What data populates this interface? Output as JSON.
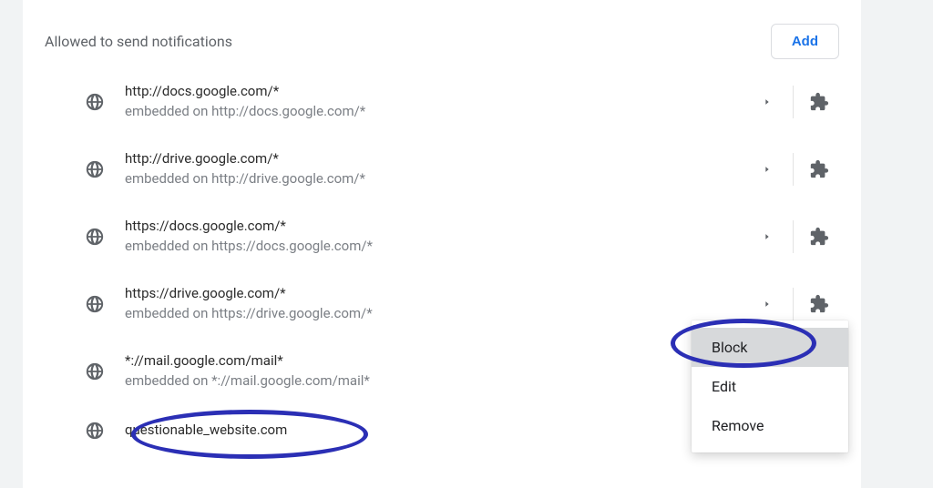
{
  "header": {
    "title": "Allowed to send notifications",
    "add_label": "Add"
  },
  "sites": [
    {
      "url": "http://docs.google.com/*",
      "embed": "embedded on http://docs.google.com/*",
      "show_icons": true
    },
    {
      "url": "http://drive.google.com/*",
      "embed": "embedded on http://drive.google.com/*",
      "show_icons": true
    },
    {
      "url": "https://docs.google.com/*",
      "embed": "embedded on https://docs.google.com/*",
      "show_icons": true
    },
    {
      "url": "https://drive.google.com/*",
      "embed": "embedded on https://drive.google.com/*",
      "show_icons": true
    },
    {
      "url": "*://mail.google.com/mail*",
      "embed": "embedded on *://mail.google.com/mail*",
      "show_icons": false
    },
    {
      "url": "questionable_website.com",
      "embed": "",
      "show_icons": false
    }
  ],
  "menu": {
    "block": "Block",
    "edit": "Edit",
    "remove": "Remove"
  }
}
